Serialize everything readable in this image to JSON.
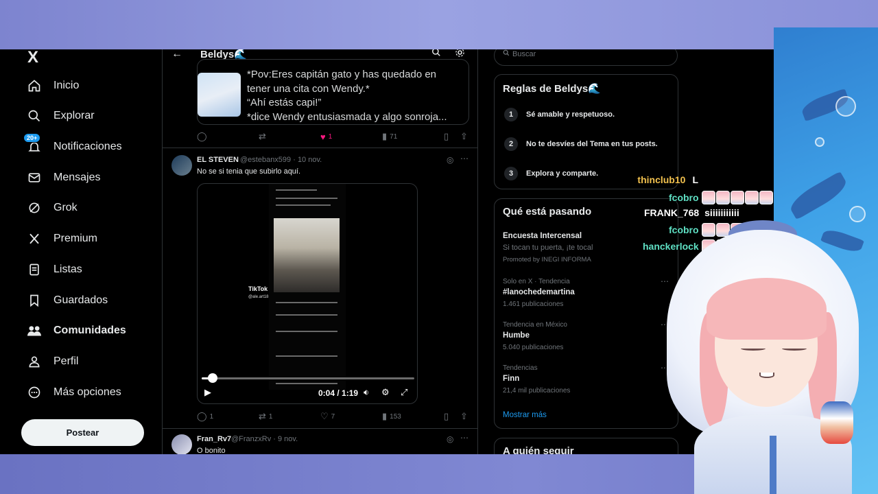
{
  "colors": {
    "accent": "#1d9bf0",
    "like": "#f91880",
    "bg": "#000000",
    "muted": "#71767b"
  },
  "nav": {
    "logo": "X",
    "badge": "20+",
    "items": [
      {
        "label": "Inicio",
        "icon": "home-icon"
      },
      {
        "label": "Explorar",
        "icon": "search-icon"
      },
      {
        "label": "Notificaciones",
        "icon": "bell-icon"
      },
      {
        "label": "Mensajes",
        "icon": "mail-icon"
      },
      {
        "label": "Grok",
        "icon": "grok-icon"
      },
      {
        "label": "Premium",
        "icon": "x-premium-icon"
      },
      {
        "label": "Listas",
        "icon": "list-icon"
      },
      {
        "label": "Guardados",
        "icon": "bookmark-icon"
      },
      {
        "label": "Comunidades",
        "icon": "communities-icon"
      },
      {
        "label": "Perfil",
        "icon": "profile-icon"
      },
      {
        "label": "Más opciones",
        "icon": "more-circle-icon"
      }
    ],
    "post_button": "Postear"
  },
  "timeline": {
    "title": "Beldys🌊",
    "quote": {
      "lines": [
        "*Pov:Eres capitán gato y has quedado en",
        "tener una cita con Wendy.*",
        "“Ahí estás capi!”",
        "*dice Wendy entusiasmada y algo sonroja..."
      ]
    },
    "quote_actions": {
      "likes": "1",
      "views": "71"
    },
    "tweet1": {
      "name": "EL STEVEN",
      "handle": "@estebanx599 · 10 nov.",
      "text": "No se si tenia que subirlo aquí.",
      "video": {
        "brand": "TikTok",
        "user": "@ale.art18",
        "time": "0:04 / 1:19",
        "progress": 0.05
      },
      "actions": {
        "replies": "1",
        "reposts": "1",
        "likes": "7",
        "views": "153"
      }
    },
    "tweet2": {
      "name": "Fran_Rv7",
      "handle": "@FranzxRv · 9 nov.",
      "text": "O bonito"
    }
  },
  "right": {
    "search_placeholder": "Buscar",
    "rules_title": "Reglas de Beldys🌊",
    "rules": [
      {
        "num": "1",
        "text": "Sé amable y respetuoso."
      },
      {
        "num": "2",
        "text": "No te desvíes del Tema en tus posts."
      },
      {
        "num": "3",
        "text": "Explora y comparte."
      }
    ],
    "trends_title": "Qué está pasando",
    "promo": {
      "name": "Encuesta Intercensal",
      "desc": "Si tocan tu puerta, ¡te tocal",
      "by": "Promoted by INEGI INFORMA"
    },
    "trends": [
      {
        "meta": "Solo en X · Tendencia",
        "name": "#lanochedemartina",
        "count": "1.461 publicaciones"
      },
      {
        "meta": "Tendencia en México",
        "name": "Humbe",
        "count": "5.040 publicaciones"
      },
      {
        "meta": "Tendencias",
        "name": "Finn",
        "count": "21,4 mil publicaciones"
      }
    ],
    "show_more": "Mostrar más",
    "follow_title": "A quién seguir"
  },
  "chat": [
    {
      "user": "thinclub10",
      "color": "#f2c14e",
      "msg": "L",
      "emotes": 0
    },
    {
      "user": "fcobro",
      "color": "#5fe0c4",
      "msg": "",
      "emotes": 5
    },
    {
      "user": "FRANK_768",
      "color": "#ffffff",
      "msg": "siiiiiiiiiii",
      "emotes": 0
    },
    {
      "user": "fcobro",
      "color": "#5fe0c4",
      "msg": "",
      "emotes": 3
    },
    {
      "user": "hanckerlock",
      "color": "#5fe0c4",
      "msg": "",
      "emotes": 3
    }
  ]
}
